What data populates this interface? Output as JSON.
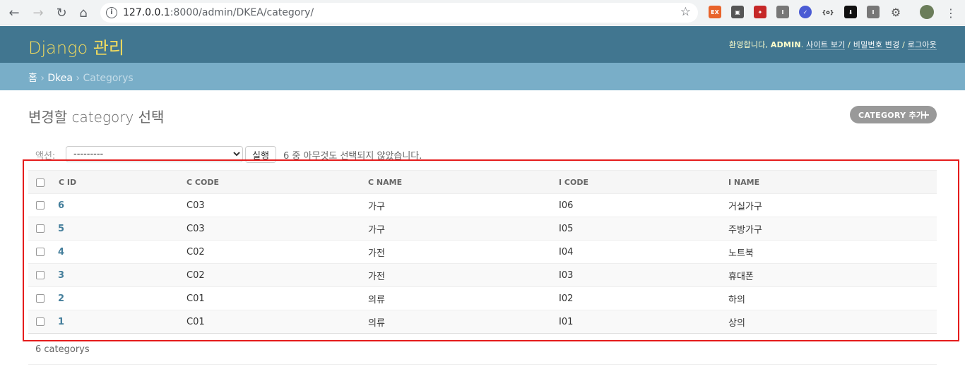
{
  "browser": {
    "url_host": "127.0.0.1",
    "url_path": ":8000/admin/DKEA/category/"
  },
  "header": {
    "branding": "Django 관리",
    "welcome": "환영합니다,",
    "username": "ADMIN",
    "links": [
      "사이트 보기",
      "비밀번호 변경",
      "로그아웃"
    ]
  },
  "breadcrumbs": {
    "home": "홈",
    "app": "Dkea",
    "current": "Categorys"
  },
  "page": {
    "title": "변경할 category 선택",
    "add_label": "CATEGORY 추가"
  },
  "actions": {
    "label": "액션:",
    "selected": "---------",
    "go_label": "실행",
    "counter": "6 중 아무것도 선택되지 않았습니다."
  },
  "table": {
    "headers": [
      "C ID",
      "C CODE",
      "C NAME",
      "I CODE",
      "I NAME"
    ],
    "rows": [
      {
        "c_id": "6",
        "c_code": "C03",
        "c_name": "가구",
        "i_code": "I06",
        "i_name": "거실가구"
      },
      {
        "c_id": "5",
        "c_code": "C03",
        "c_name": "가구",
        "i_code": "I05",
        "i_name": "주방가구"
      },
      {
        "c_id": "4",
        "c_code": "C02",
        "c_name": "가전",
        "i_code": "I04",
        "i_name": "노트북"
      },
      {
        "c_id": "3",
        "c_code": "C02",
        "c_name": "가전",
        "i_code": "I03",
        "i_name": "휴대폰"
      },
      {
        "c_id": "2",
        "c_code": "C01",
        "c_name": "의류",
        "i_code": "I02",
        "i_name": "하의"
      },
      {
        "c_id": "1",
        "c_code": "C01",
        "c_name": "의류",
        "i_code": "I01",
        "i_name": "상의"
      }
    ]
  },
  "paginator": "6 categorys",
  "colors": {
    "header_bg": "#417690",
    "breadcrumb_bg": "#79aec8",
    "branding": "#f5dd5d",
    "link": "#447e9b",
    "highlight": "#e51c1c"
  }
}
